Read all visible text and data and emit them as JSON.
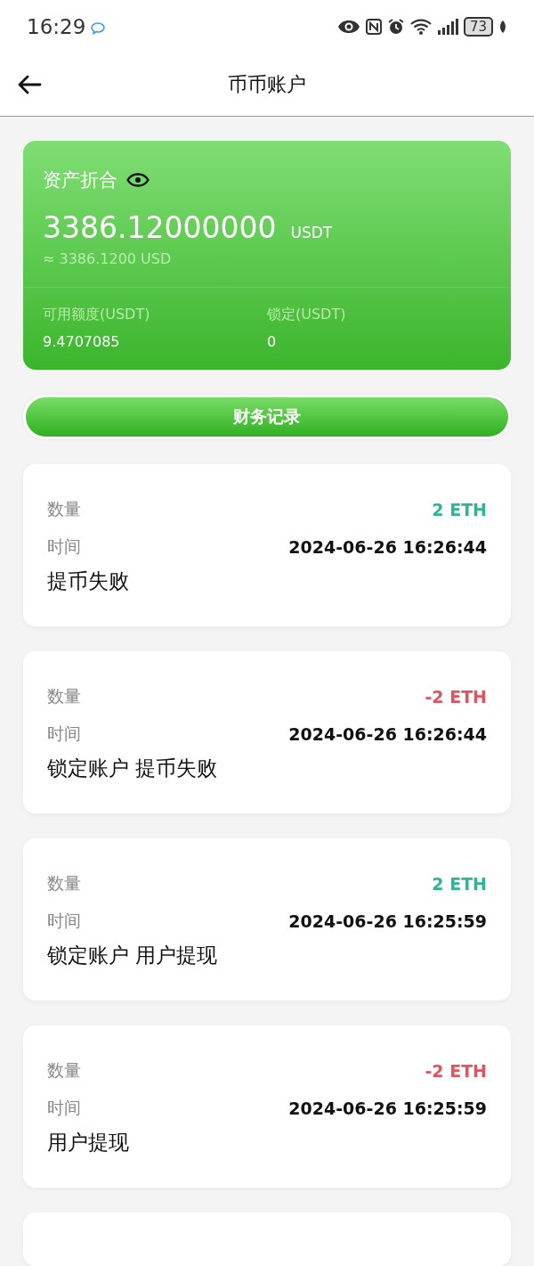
{
  "status_bar": {
    "time": "16:29",
    "battery": "73"
  },
  "header": {
    "title": "币币账户"
  },
  "balance_card": {
    "label": "资产折合",
    "amount": "3386.12000000",
    "unit": "USDT",
    "approx": "≈ 3386.1200 USD",
    "stats": [
      {
        "label": "可用额度(USDT)",
        "value": "9.4707085"
      },
      {
        "label": "锁定(USDT)",
        "value": "0"
      }
    ]
  },
  "records_button": {
    "label": "财务记录"
  },
  "records": [
    {
      "amount_label": "数量",
      "amount": "2 ETH",
      "kind": "credit",
      "time_label": "时间",
      "time": "2024-06-26 16:26:44",
      "description": "提币失败"
    },
    {
      "amount_label": "数量",
      "amount": "-2 ETH",
      "kind": "debit",
      "time_label": "时间",
      "time": "2024-06-26 16:26:44",
      "description": "锁定账户 提币失败"
    },
    {
      "amount_label": "数量",
      "amount": "2 ETH",
      "kind": "credit",
      "time_label": "时间",
      "time": "2024-06-26 16:25:59",
      "description": "锁定账户 用户提现"
    },
    {
      "amount_label": "数量",
      "amount": "-2 ETH",
      "kind": "debit",
      "time_label": "时间",
      "time": "2024-06-26 16:25:59",
      "description": "用户提现"
    }
  ]
}
